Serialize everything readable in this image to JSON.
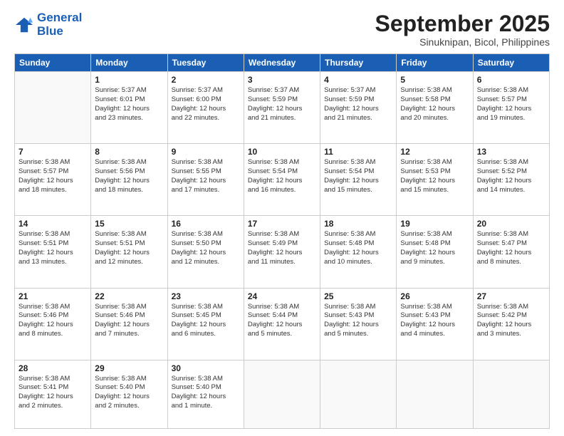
{
  "logo": {
    "line1": "General",
    "line2": "Blue"
  },
  "title": "September 2025",
  "subtitle": "Sinuknipan, Bicol, Philippines",
  "days_header": [
    "Sunday",
    "Monday",
    "Tuesday",
    "Wednesday",
    "Thursday",
    "Friday",
    "Saturday"
  ],
  "weeks": [
    [
      {
        "day": "",
        "info": ""
      },
      {
        "day": "1",
        "info": "Sunrise: 5:37 AM\nSunset: 6:01 PM\nDaylight: 12 hours\nand 23 minutes."
      },
      {
        "day": "2",
        "info": "Sunrise: 5:37 AM\nSunset: 6:00 PM\nDaylight: 12 hours\nand 22 minutes."
      },
      {
        "day": "3",
        "info": "Sunrise: 5:37 AM\nSunset: 5:59 PM\nDaylight: 12 hours\nand 21 minutes."
      },
      {
        "day": "4",
        "info": "Sunrise: 5:37 AM\nSunset: 5:59 PM\nDaylight: 12 hours\nand 21 minutes."
      },
      {
        "day": "5",
        "info": "Sunrise: 5:38 AM\nSunset: 5:58 PM\nDaylight: 12 hours\nand 20 minutes."
      },
      {
        "day": "6",
        "info": "Sunrise: 5:38 AM\nSunset: 5:57 PM\nDaylight: 12 hours\nand 19 minutes."
      }
    ],
    [
      {
        "day": "7",
        "info": "Sunrise: 5:38 AM\nSunset: 5:57 PM\nDaylight: 12 hours\nand 18 minutes."
      },
      {
        "day": "8",
        "info": "Sunrise: 5:38 AM\nSunset: 5:56 PM\nDaylight: 12 hours\nand 18 minutes."
      },
      {
        "day": "9",
        "info": "Sunrise: 5:38 AM\nSunset: 5:55 PM\nDaylight: 12 hours\nand 17 minutes."
      },
      {
        "day": "10",
        "info": "Sunrise: 5:38 AM\nSunset: 5:54 PM\nDaylight: 12 hours\nand 16 minutes."
      },
      {
        "day": "11",
        "info": "Sunrise: 5:38 AM\nSunset: 5:54 PM\nDaylight: 12 hours\nand 15 minutes."
      },
      {
        "day": "12",
        "info": "Sunrise: 5:38 AM\nSunset: 5:53 PM\nDaylight: 12 hours\nand 15 minutes."
      },
      {
        "day": "13",
        "info": "Sunrise: 5:38 AM\nSunset: 5:52 PM\nDaylight: 12 hours\nand 14 minutes."
      }
    ],
    [
      {
        "day": "14",
        "info": "Sunrise: 5:38 AM\nSunset: 5:51 PM\nDaylight: 12 hours\nand 13 minutes."
      },
      {
        "day": "15",
        "info": "Sunrise: 5:38 AM\nSunset: 5:51 PM\nDaylight: 12 hours\nand 12 minutes."
      },
      {
        "day": "16",
        "info": "Sunrise: 5:38 AM\nSunset: 5:50 PM\nDaylight: 12 hours\nand 12 minutes."
      },
      {
        "day": "17",
        "info": "Sunrise: 5:38 AM\nSunset: 5:49 PM\nDaylight: 12 hours\nand 11 minutes."
      },
      {
        "day": "18",
        "info": "Sunrise: 5:38 AM\nSunset: 5:48 PM\nDaylight: 12 hours\nand 10 minutes."
      },
      {
        "day": "19",
        "info": "Sunrise: 5:38 AM\nSunset: 5:48 PM\nDaylight: 12 hours\nand 9 minutes."
      },
      {
        "day": "20",
        "info": "Sunrise: 5:38 AM\nSunset: 5:47 PM\nDaylight: 12 hours\nand 8 minutes."
      }
    ],
    [
      {
        "day": "21",
        "info": "Sunrise: 5:38 AM\nSunset: 5:46 PM\nDaylight: 12 hours\nand 8 minutes."
      },
      {
        "day": "22",
        "info": "Sunrise: 5:38 AM\nSunset: 5:46 PM\nDaylight: 12 hours\nand 7 minutes."
      },
      {
        "day": "23",
        "info": "Sunrise: 5:38 AM\nSunset: 5:45 PM\nDaylight: 12 hours\nand 6 minutes."
      },
      {
        "day": "24",
        "info": "Sunrise: 5:38 AM\nSunset: 5:44 PM\nDaylight: 12 hours\nand 5 minutes."
      },
      {
        "day": "25",
        "info": "Sunrise: 5:38 AM\nSunset: 5:43 PM\nDaylight: 12 hours\nand 5 minutes."
      },
      {
        "day": "26",
        "info": "Sunrise: 5:38 AM\nSunset: 5:43 PM\nDaylight: 12 hours\nand 4 minutes."
      },
      {
        "day": "27",
        "info": "Sunrise: 5:38 AM\nSunset: 5:42 PM\nDaylight: 12 hours\nand 3 minutes."
      }
    ],
    [
      {
        "day": "28",
        "info": "Sunrise: 5:38 AM\nSunset: 5:41 PM\nDaylight: 12 hours\nand 2 minutes."
      },
      {
        "day": "29",
        "info": "Sunrise: 5:38 AM\nSunset: 5:40 PM\nDaylight: 12 hours\nand 2 minutes."
      },
      {
        "day": "30",
        "info": "Sunrise: 5:38 AM\nSunset: 5:40 PM\nDaylight: 12 hours\nand 1 minute."
      },
      {
        "day": "",
        "info": ""
      },
      {
        "day": "",
        "info": ""
      },
      {
        "day": "",
        "info": ""
      },
      {
        "day": "",
        "info": ""
      }
    ]
  ]
}
